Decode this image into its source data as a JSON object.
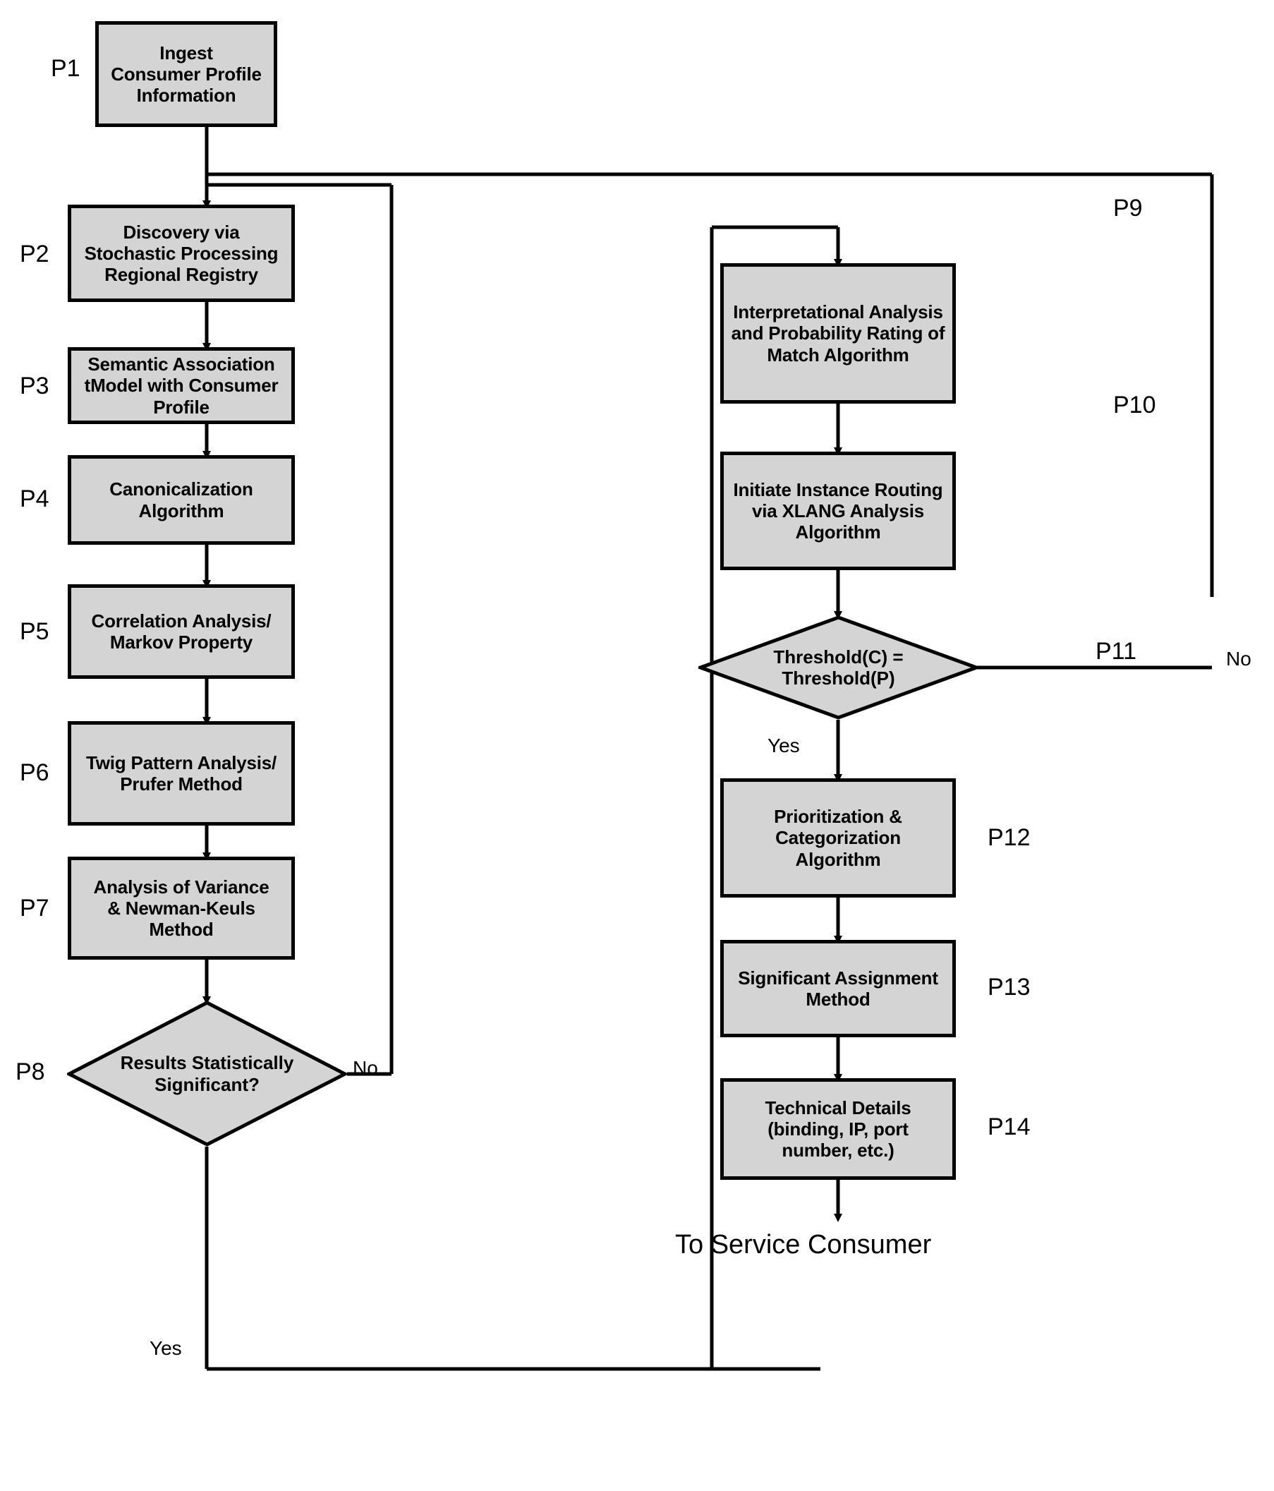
{
  "diagram": {
    "title_note": "",
    "nodes": [
      {
        "tag": "P1",
        "text": "Ingest\nConsumer Profile\nInformation",
        "shape": "process"
      },
      {
        "tag": "P2",
        "text": "Discovery via\nStochastic Processing\nRegional Registry",
        "shape": "process"
      },
      {
        "tag": "P3",
        "text": "Semantic Association\ntModel with Consumer\nProfile",
        "shape": "process"
      },
      {
        "tag": "P4",
        "text": "Canonicalization\nAlgorithm",
        "shape": "process"
      },
      {
        "tag": "P5",
        "text": "Correlation Analysis/\nMarkov Property",
        "shape": "process"
      },
      {
        "tag": "P6",
        "text": "Twig Pattern Analysis/\nPrufer Method",
        "shape": "process"
      },
      {
        "tag": "P7",
        "text": "Analysis of Variance\n& Newman-Keuls\nMethod",
        "shape": "process"
      },
      {
        "tag": "P8",
        "text": "Results Statistically\nSignificant?",
        "shape": "decision"
      },
      {
        "tag": "P9",
        "text": "Interpretational Analysis\nand Probability Rating of\nMatch Algorithm",
        "shape": "process"
      },
      {
        "tag": "P10",
        "text": "Initiate Instance Routing\nvia XLANG Analysis\nAlgorithm",
        "shape": "process"
      },
      {
        "tag": "P11",
        "text": "Threshold(C) =\nThreshold(P)",
        "shape": "decision"
      },
      {
        "tag": "P12",
        "text": "Prioritization &\nCategorization\nAlgorithm",
        "shape": "process"
      },
      {
        "tag": "P13",
        "text": "Significant Assignment\nMethod",
        "shape": "process"
      },
      {
        "tag": "P14",
        "text": "Technical Details\n(binding, IP, port\nnumber, etc.)",
        "shape": "process"
      }
    ],
    "edge_labels": {
      "p8_no": "No",
      "p8_yes": "Yes",
      "p11_no": "No",
      "p11_yes": "Yes"
    },
    "terminal": "To Service Consumer",
    "colors": {
      "node_fill": "#d4d4d4",
      "stroke": "#000000",
      "background": "#ffffff"
    }
  }
}
